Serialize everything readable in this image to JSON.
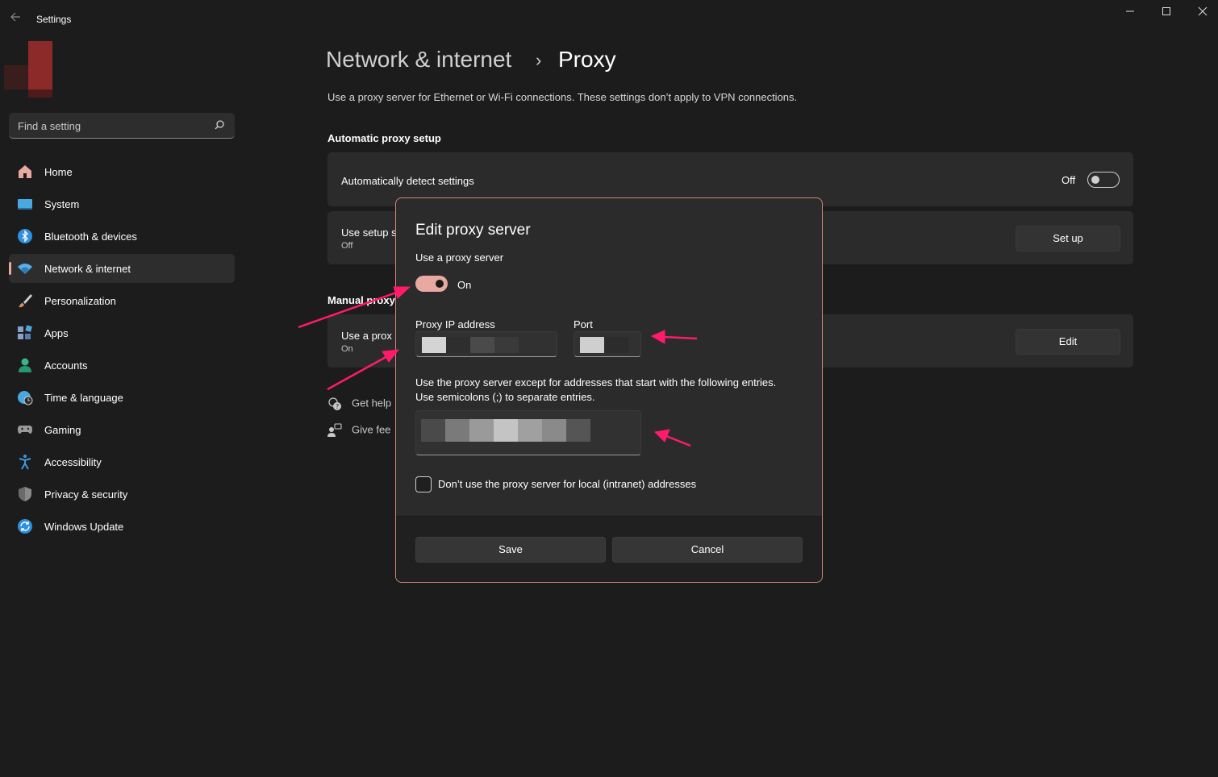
{
  "window": {
    "title": "Settings",
    "controls": [
      "minimize",
      "maximize",
      "close"
    ]
  },
  "sidebar": {
    "search_placeholder": "Find a setting",
    "items": [
      {
        "label": "Home",
        "icon": "home-icon",
        "color": "#e8a9a0"
      },
      {
        "label": "System",
        "icon": "system-icon",
        "color": "#4aa8e0"
      },
      {
        "label": "Bluetooth & devices",
        "icon": "bluetooth-icon",
        "color": "#2f8fe0"
      },
      {
        "label": "Network & internet",
        "icon": "wifi-icon",
        "color": "#5aaee8",
        "active": true
      },
      {
        "label": "Personalization",
        "icon": "brush-icon",
        "color": "#d89060"
      },
      {
        "label": "Apps",
        "icon": "apps-icon",
        "color": "#8aa0c8"
      },
      {
        "label": "Accounts",
        "icon": "accounts-icon",
        "color": "#3ab58a"
      },
      {
        "label": "Time & language",
        "icon": "globe-clock-icon",
        "color": "#4aa8e0"
      },
      {
        "label": "Gaming",
        "icon": "gamepad-icon",
        "color": "#9a9a9a"
      },
      {
        "label": "Accessibility",
        "icon": "accessibility-icon",
        "color": "#3a9ae0"
      },
      {
        "label": "Privacy & security",
        "icon": "shield-icon",
        "color": "#8a8a8a"
      },
      {
        "label": "Windows Update",
        "icon": "update-icon",
        "color": "#2f8fe0"
      }
    ]
  },
  "main": {
    "breadcrumb_section": "Network & internet",
    "breadcrumb_separator": "›",
    "breadcrumb_page": "Proxy",
    "description": "Use a proxy server for Ethernet or Wi-Fi connections. These settings don’t apply to VPN connections.",
    "auto_section": "Automatic proxy setup",
    "auto_detect": {
      "label": "Automatically detect settings",
      "state": "Off"
    },
    "setup_script": {
      "label": "Use setup s",
      "sub": "Off",
      "button": "Set up"
    },
    "manual_section": "Manual proxy",
    "manual_proxy": {
      "label": "Use a prox",
      "sub": "On",
      "button": "Edit"
    },
    "get_help": "Get help",
    "give_feedback": "Give fee"
  },
  "dialog": {
    "title": "Edit proxy server",
    "use_proxy_label": "Use a proxy server",
    "toggle_state": "On",
    "ip_label": "Proxy IP address",
    "port_label": "Port",
    "exceptions_line1": "Use the proxy server except for addresses that start with the following entries.",
    "exceptions_line2": "Use semicolons (;) to separate entries.",
    "local_checkbox_label": "Don’t use the proxy server for local (intranet) addresses",
    "save": "Save",
    "cancel": "Cancel"
  },
  "colors": {
    "accent": "#e8a9a0",
    "annotation": "#ff1a6b",
    "background": "#1c1c1c",
    "card": "#2b2b2b"
  }
}
